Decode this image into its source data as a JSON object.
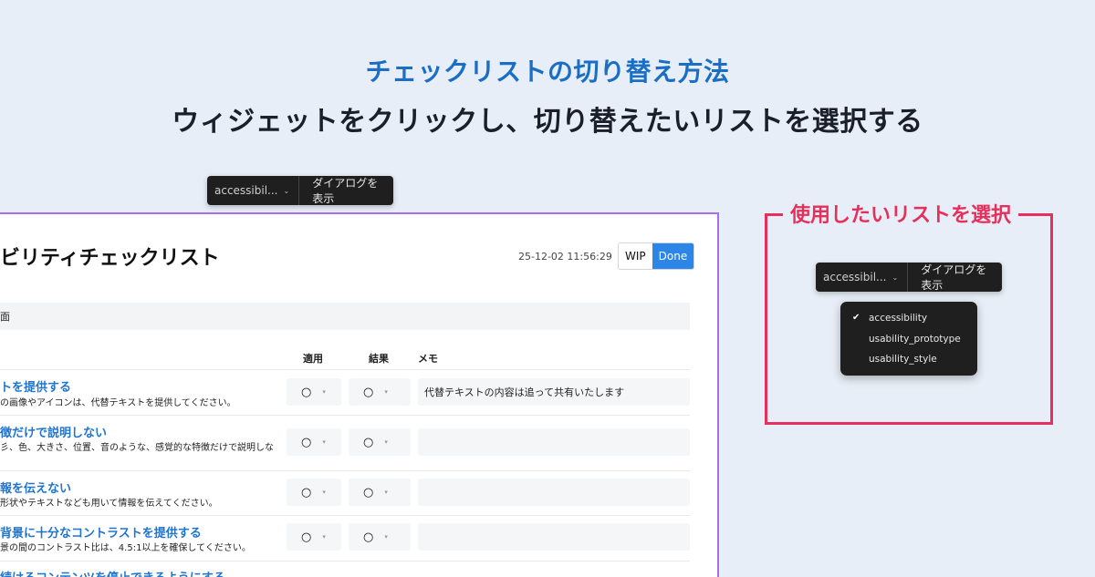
{
  "heading": {
    "title": "チェックリストの切り替え方法",
    "subtitle": "ウィジェットをクリックし、切り替えたいリストを選択する"
  },
  "widget": {
    "selected": "accessibil...",
    "dialog_label": "ダイアログを表示"
  },
  "panel": {
    "title": "ビリティチェックリスト",
    "timestamp": "25-12-02 11:56:29",
    "wip_label": "WIP",
    "done_label": "Done",
    "section": "面",
    "columns": {
      "apply": "適用",
      "result": "結果",
      "memo": "メモ"
    },
    "rows": [
      {
        "title": "トを提供する",
        "desc": "の画像やアイコンは、代替テキストを提供してください。",
        "apply": "○",
        "result": "○",
        "memo": "代替テキストの内容は追って共有いたします"
      },
      {
        "title": "徴だけで説明しない",
        "desc": "彡、色、大きさ、位置、音のような、感覚的な特徴だけで説明しな",
        "apply": "○",
        "result": "○",
        "memo": ""
      },
      {
        "title": "報を伝えない",
        "desc": "形状やテキストなども用いて情報を伝えてください。",
        "apply": "○",
        "result": "○",
        "memo": ""
      },
      {
        "title": "背景に十分なコントラストを提供する",
        "desc": "景の間のコントラスト比は、4.5:1以上を確保してください。",
        "apply": "○",
        "result": "○",
        "memo": ""
      },
      {
        "title": "続けるコンテンツを停止できるようにする",
        "desc": "",
        "apply": "○",
        "result": "○",
        "memo": ""
      }
    ]
  },
  "right": {
    "label": "使用したいリストを選択",
    "options": [
      {
        "label": "accessibility",
        "checked": true
      },
      {
        "label": "usability_prototype",
        "checked": false
      },
      {
        "label": "usability_style",
        "checked": false
      }
    ]
  }
}
